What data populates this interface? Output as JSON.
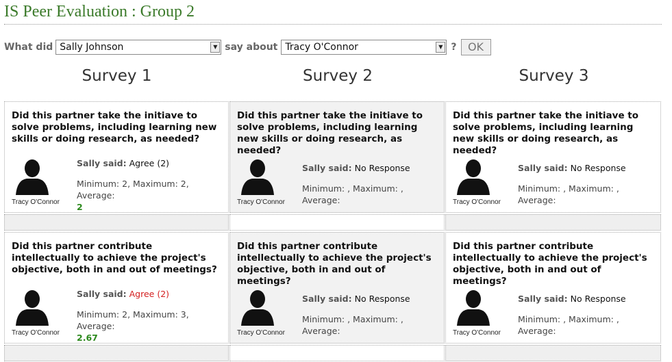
{
  "header": {
    "title": "IS Peer Evaluation : Group 2"
  },
  "filter": {
    "what_did_label": "What did",
    "reviewer_selected": "Sally Johnson",
    "say_about_label": "say about",
    "subject_selected": "Tracy O'Connor",
    "question_mark": "?",
    "ok_label": "OK"
  },
  "surveys": [
    {
      "title": "Survey 1"
    },
    {
      "title": "Survey 2"
    },
    {
      "title": "Survey 3"
    }
  ],
  "questions": [
    {
      "text": "Did this partner take the initiave to solve problems, including learning new skills or doing research, as needed?",
      "cells": [
        {
          "caption": "Tracy O'Connor",
          "said_label": "Sally said:",
          "said_value": "Agree (2)",
          "said_color": "normal",
          "stats": "Minimum: 2, Maximum: 2, Average:",
          "average": "2"
        },
        {
          "caption": "Tracy O'Connor",
          "said_label": "Sally said:",
          "said_value": "No Response",
          "said_color": "normal",
          "stats": "Minimum: , Maximum: , Average:",
          "average": ""
        },
        {
          "caption": "Tracy O'Connor",
          "said_label": "Sally said:",
          "said_value": "No Response",
          "said_color": "normal",
          "stats": "Minimum: , Maximum: , Average:",
          "average": ""
        }
      ]
    },
    {
      "text": "Did this partner contribute intellectually to achieve the project's objective, both in and out of meetings?",
      "cells": [
        {
          "caption": "Tracy O'Connor",
          "said_label": "Sally said:",
          "said_value": "Agree (2)",
          "said_color": "red",
          "stats": "Minimum: 2, Maximum: 3, Average:",
          "average": "2.67"
        },
        {
          "caption": "Tracy O'Connor",
          "said_label": "Sally said:",
          "said_value": "No Response",
          "said_color": "normal",
          "stats": "Minimum: , Maximum: , Average:",
          "average": ""
        },
        {
          "caption": "Tracy O'Connor",
          "said_label": "Sally said:",
          "said_value": "No Response",
          "said_color": "normal",
          "stats": "Minimum: , Maximum: , Average:",
          "average": ""
        }
      ]
    }
  ],
  "colors": {
    "title_green": "#3b7a2a",
    "average_green": "#2d8a1e",
    "flag_red": "#d42020"
  }
}
